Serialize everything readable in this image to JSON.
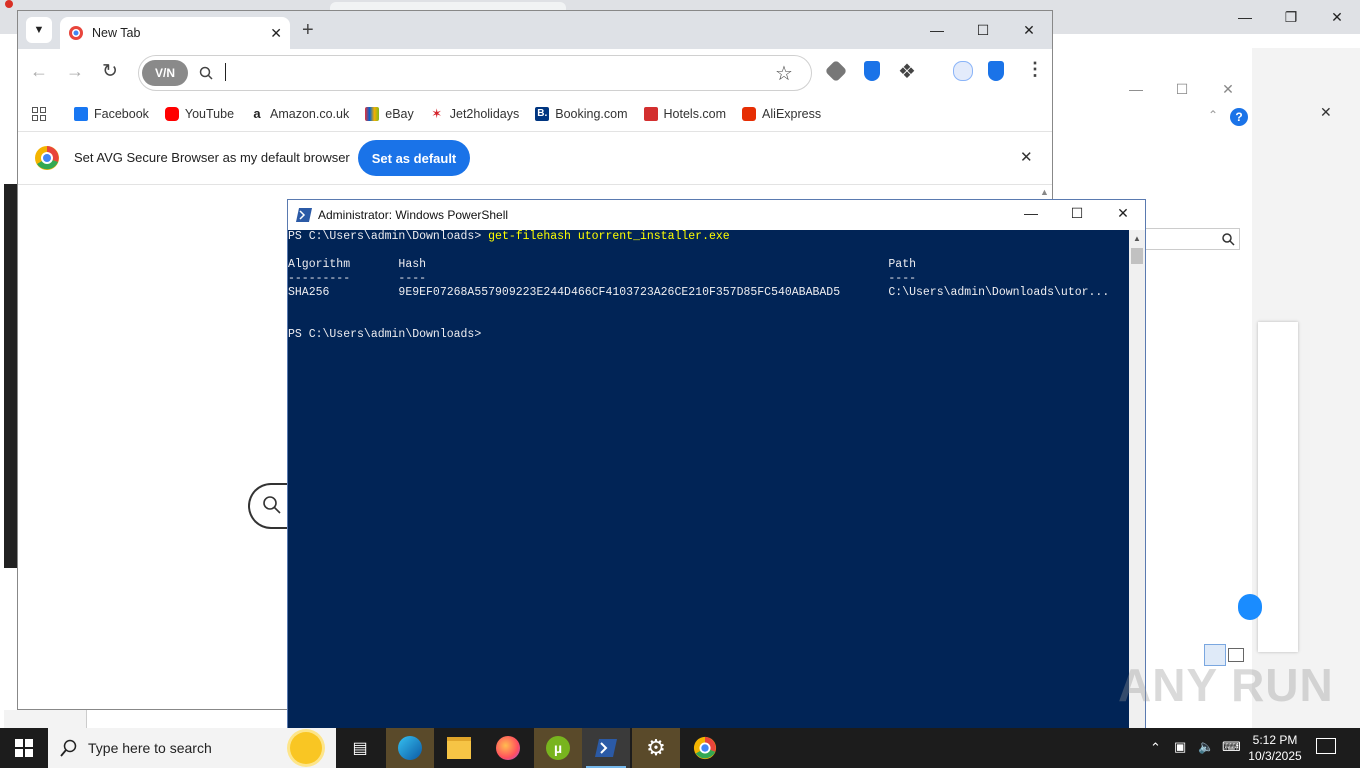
{
  "browser": {
    "tab_title": "New Tab",
    "vpn_label": "V/N",
    "omnibox_value": "",
    "bookmarks": [
      {
        "label": "Facebook",
        "color": "#1877f2"
      },
      {
        "label": "YouTube",
        "color": "#ff0000"
      },
      {
        "label": "Amazon.co.uk",
        "color": "#222222"
      },
      {
        "label": "eBay",
        "color": "#e53238"
      },
      {
        "label": "Jet2holidays",
        "color": "#d4232b"
      },
      {
        "label": "Booking.com",
        "color": "#003580"
      },
      {
        "label": "Hotels.com",
        "color": "#d32f2f"
      },
      {
        "label": "AliExpress",
        "color": "#e62e04"
      }
    ],
    "infobar_text": "Set AVG Secure Browser as my default browser",
    "set_default_label": "Set as default"
  },
  "powershell": {
    "title": "Administrator: Windows PowerShell",
    "prompt1": "PS C:\\Users\\admin\\Downloads> ",
    "command": "get-filehash utorrent_installer.exe",
    "header_line": "Algorithm       Hash                                                                   Path",
    "dash_line": "---------       ----                                                                   ----",
    "row_line": "SHA256          9E9EF07268A557909223E244D466CF4103723A26CE210F357D85FC540ABABAD5       C:\\Users\\admin\\Downloads\\utor...",
    "prompt2": "PS C:\\Users\\admin\\Downloads>"
  },
  "taskbar": {
    "search_placeholder": "Type here to search",
    "time": "5:12 PM",
    "date": "10/3/2025"
  },
  "watermark": "ANY RUN"
}
